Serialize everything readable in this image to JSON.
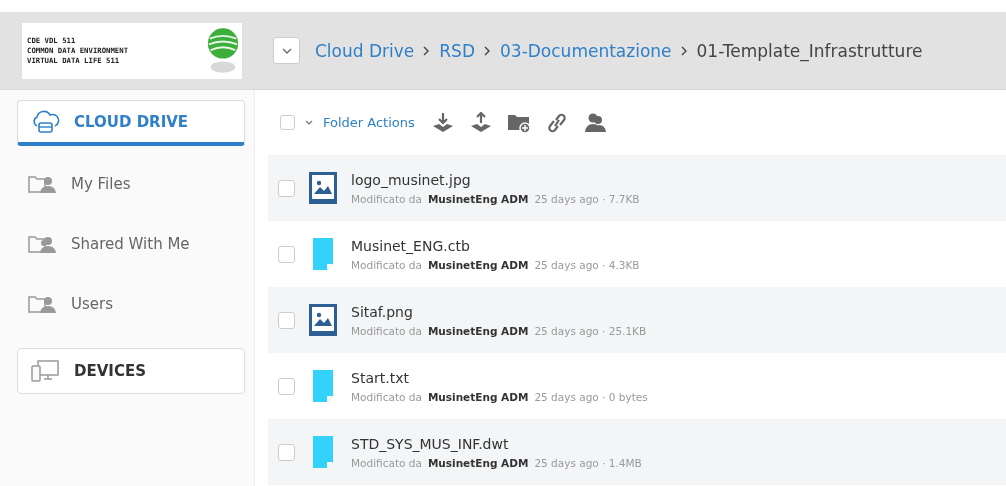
{
  "logo": {
    "lines": [
      "CDE VDL 511",
      "COMMON DATA ENVIRONMENT",
      "VIRTUAL DATA LIFE 511"
    ]
  },
  "breadcrumb": [
    "Cloud Drive",
    "RSD",
    "03-Documentazione",
    "01-Template_Infrastrutture"
  ],
  "sidebar": {
    "sections": [
      {
        "label": "CLOUD DRIVE",
        "kind": "cloud",
        "selected": true,
        "items": [
          {
            "label": "My Files",
            "kind": "user-folder"
          },
          {
            "label": "Shared With Me",
            "kind": "shared-folder"
          },
          {
            "label": "Users",
            "kind": "user-folder"
          }
        ]
      },
      {
        "label": "DEVICES",
        "kind": "devices",
        "selected": false
      }
    ]
  },
  "toolbar": {
    "select_all_checked": false,
    "label": "Folder Actions"
  },
  "files": [
    {
      "name": "logo_musinet.jpg",
      "kind": "image",
      "checked": false,
      "prefix": "Modificato da",
      "user": "MusinetEng ADM",
      "info": "25 days ago · 7.7KB"
    },
    {
      "name": "Musinet_ENG.ctb",
      "kind": "file",
      "checked": false,
      "prefix": "Modificato da",
      "user": "MusinetEng ADM",
      "info": "25 days ago · 4.3KB"
    },
    {
      "name": "Sitaf.png",
      "kind": "image",
      "checked": false,
      "prefix": "Modificato da",
      "user": "MusinetEng ADM",
      "info": "25 days ago · 25.1KB"
    },
    {
      "name": "Start.txt",
      "kind": "file",
      "checked": false,
      "prefix": "Modificato da",
      "user": "MusinetEng ADM",
      "info": "25 days ago · 0 bytes"
    },
    {
      "name": "STD_SYS_MUS_INF.dwt",
      "kind": "file",
      "checked": false,
      "prefix": "Modificato da",
      "user": "MusinetEng ADM",
      "info": "25 days ago · 1.4MB"
    }
  ]
}
